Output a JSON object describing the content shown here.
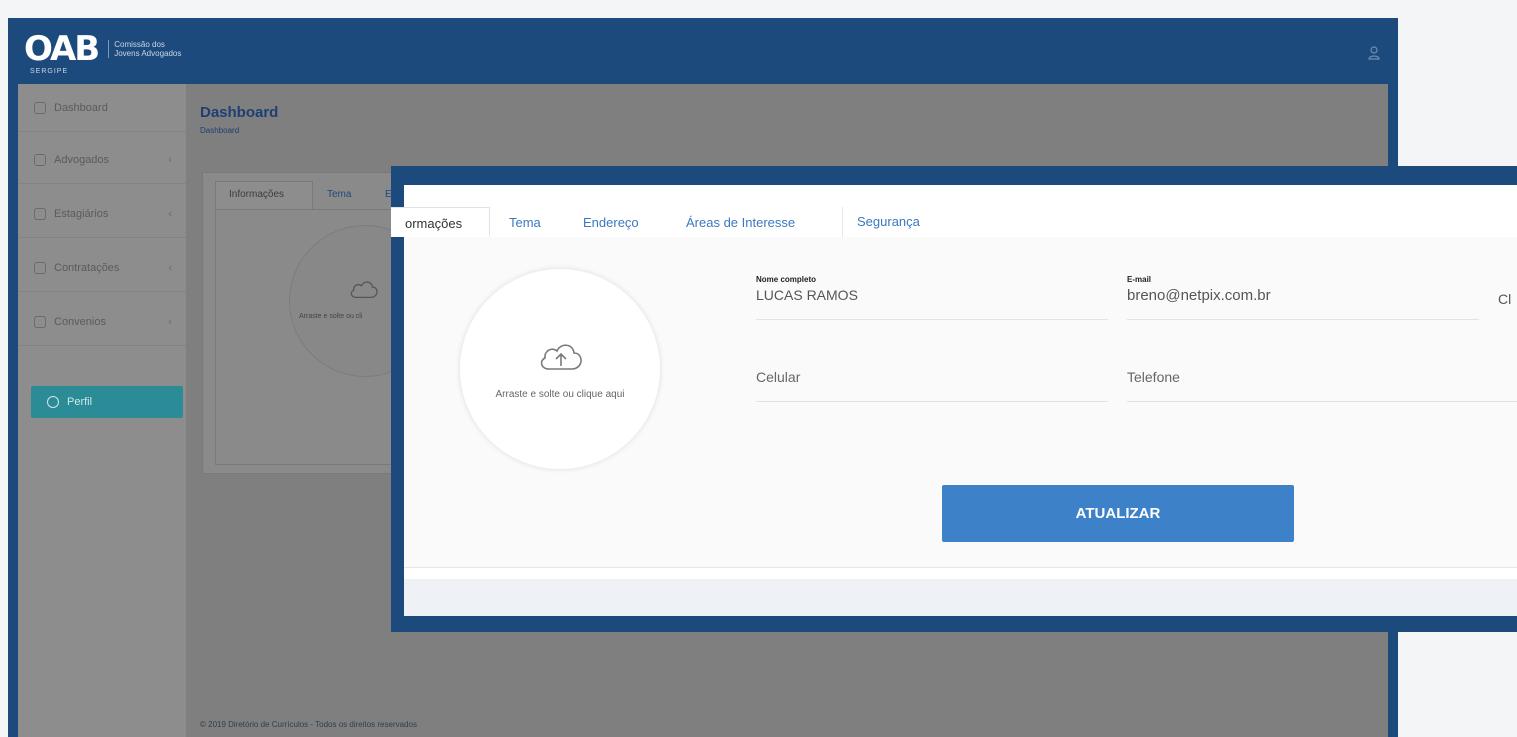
{
  "brand": {
    "logo": "OAB",
    "sub": "SERGIPE",
    "tagline": "Comissão dos Jovens Advogados"
  },
  "sidebar": {
    "items": [
      {
        "label": "Dashboard",
        "icon": "dashboard-icon"
      },
      {
        "label": "Advogados",
        "icon": "key-icon"
      },
      {
        "label": "Estagiários",
        "icon": "user-icon"
      },
      {
        "label": "Contratações",
        "icon": "briefcase-icon"
      },
      {
        "label": "Convenios",
        "icon": "chat-icon"
      },
      {
        "label": "Perfil",
        "icon": "settings-icon"
      }
    ]
  },
  "header": {
    "title": "Dashboard",
    "breadcrumb": "Dashboard"
  },
  "background_card": {
    "tabs": [
      "Informações",
      "Tema",
      "En"
    ],
    "upload_text": "Arraste e solte ou cli"
  },
  "footer": "© 2019 Diretório de Currículos - Todos os direitos reservados",
  "profile": {
    "tabs": [
      "ormações",
      "Tema",
      "Endereço",
      "Áreas de Interesse",
      "Segurança"
    ],
    "upload_text": "Arraste e solte ou clique aqui",
    "fields": {
      "name_label": "Nome completo",
      "name_value": "LUCAS RAMOS",
      "email_label": "E-mail",
      "email_value": "breno@netpix.com.br",
      "cut_label": "Cl",
      "cellphone_placeholder": "Celular",
      "phone_placeholder": "Telefone"
    },
    "submit_label": "ATUALIZAR"
  },
  "colors": {
    "primary": "#1d4a7c",
    "accent": "#3d82c8",
    "active_sidebar": "#2b8b96"
  }
}
